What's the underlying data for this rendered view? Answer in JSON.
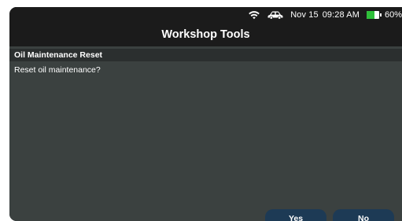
{
  "status_bar": {
    "wifi_icon": "wifi-icon",
    "car_icon": "car-icon",
    "date": "Nov 15",
    "time": "09:28 AM",
    "battery_percent_text": "60%",
    "battery_level": 0.6,
    "battery_color": "#2fbf3a"
  },
  "header": {
    "title": "Workshop Tools"
  },
  "dialog": {
    "section_title": "Oil Maintenance Reset",
    "message": "Reset oil maintenance?"
  },
  "buttons": {
    "yes_label": "Yes",
    "no_label": "No"
  },
  "colors": {
    "background": "#1b1b1b",
    "content_bg": "#3b4140",
    "section_header_bg": "#2b2f2f",
    "button_bg": "#1d3a55"
  }
}
